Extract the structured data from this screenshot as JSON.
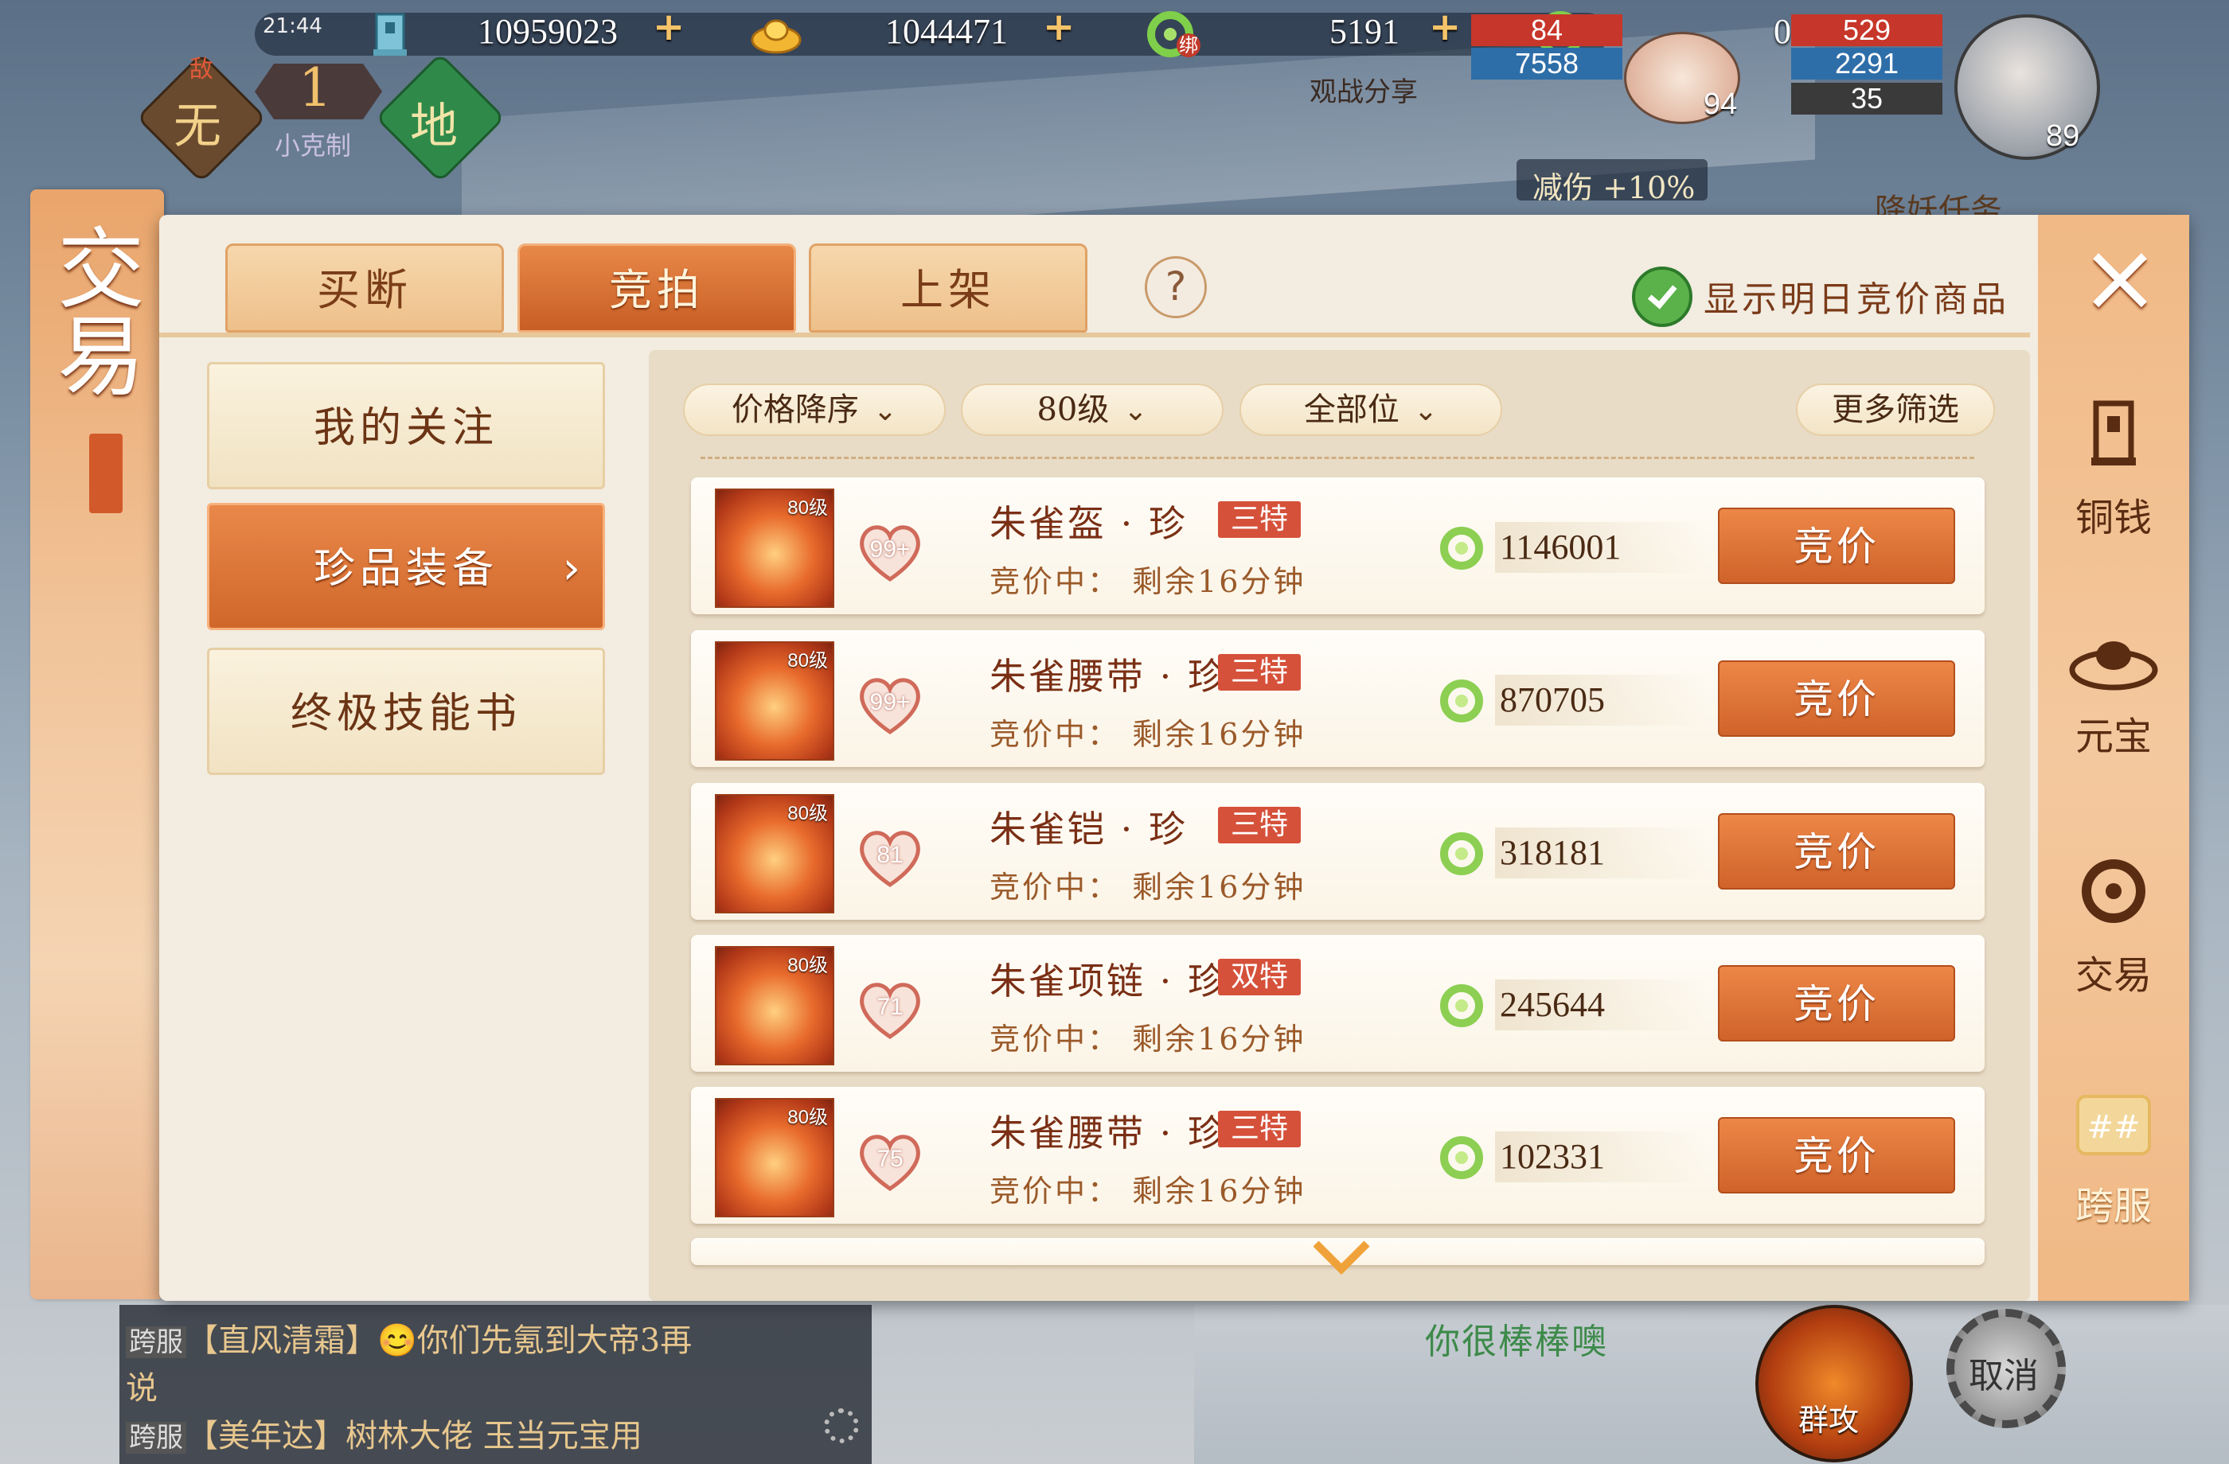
{
  "hud": {
    "time": "21:44",
    "copper": "10959023",
    "ingot": "1044471",
    "jade": "5191",
    "jade_bound": "0",
    "jade_tag": "绑",
    "spectate_label": "观战分享",
    "stats_left": [
      "84",
      "7558"
    ],
    "pet_level": "94",
    "stats_right": [
      "529",
      "2291",
      "35"
    ],
    "hero_level": "89"
  },
  "restraint": {
    "enemy_label": "敌",
    "enemy_element": "无",
    "count": "1",
    "caption": "小克制",
    "self_element": "地"
  },
  "buffs": {
    "damage_reduction": "减伤 +10%",
    "quest": "降妖任务"
  },
  "panel": {
    "banner_title": "交易",
    "banner_sub": "交易",
    "tabs": [
      "买断",
      "竞拍",
      "上架"
    ],
    "active_tab": "竞拍",
    "help": "?",
    "show_tomorrow": "显示明日竞价商品",
    "close": "×"
  },
  "sidebar": {
    "items": [
      "我的关注",
      "珍品装备",
      "终极技能书"
    ],
    "active": "珍品装备"
  },
  "filters": {
    "sort": "价格降序",
    "level": "80级",
    "slot": "全部位",
    "more": "更多筛选"
  },
  "items": [
    {
      "level": "80级",
      "likes": "99+",
      "name": "朱雀盔 · 珍",
      "tag": "三特",
      "status": "竞价中：  剩余16分钟",
      "price": "1146001",
      "button": "竞价"
    },
    {
      "level": "80级",
      "likes": "99+",
      "name": "朱雀腰带 · 珍",
      "tag": "三特",
      "status": "竞价中：  剩余16分钟",
      "price": "870705",
      "button": "竞价"
    },
    {
      "level": "80级",
      "likes": "81",
      "name": "朱雀铠 · 珍",
      "tag": "三特",
      "status": "竞价中：  剩余16分钟",
      "price": "318181",
      "button": "竞价"
    },
    {
      "level": "80级",
      "likes": "71",
      "name": "朱雀项链 · 珍",
      "tag": "双特",
      "status": "竞价中：  剩余16分钟",
      "price": "245644",
      "button": "竞价"
    },
    {
      "level": "80级",
      "likes": "75",
      "name": "朱雀腰带 · 珍",
      "tag": "三特",
      "status": "竞价中：  剩余16分钟",
      "price": "102331",
      "button": "竞价"
    }
  ],
  "rail": [
    "铜钱",
    "元宝",
    "交易",
    "跨服"
  ],
  "chat": {
    "lines": [
      {
        "tag": "跨服",
        "text": "【直风清霜】😊你们先氪到大帝3再"
      },
      {
        "tag": "",
        "text": "说"
      },
      {
        "tag": "跨服",
        "text": "【美年达】树林大佬  玉当元宝用"
      }
    ]
  },
  "bottom": {
    "praise": "你很棒棒噢",
    "attack": "群攻",
    "cancel": "取消"
  }
}
